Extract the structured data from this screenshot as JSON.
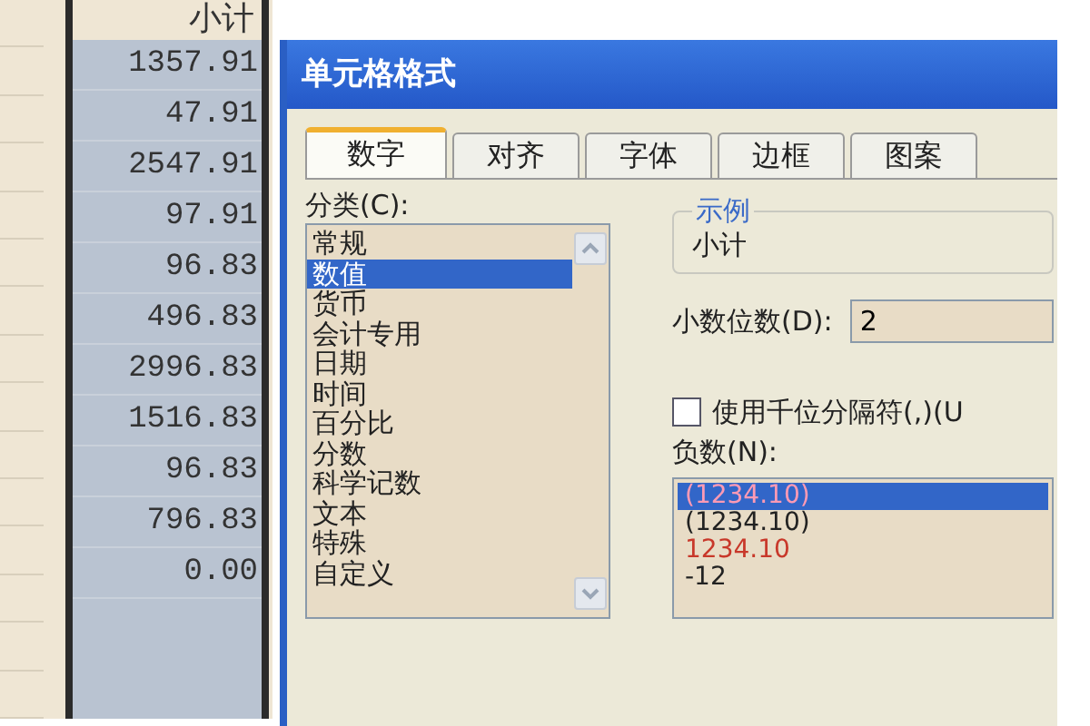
{
  "sheet": {
    "header": "小计",
    "cells": [
      "1357.91",
      "47.91",
      "2547.91",
      "97.91",
      "96.83",
      "496.83",
      "2996.83",
      "1516.83",
      "96.83",
      "796.83",
      "0.00"
    ]
  },
  "dialog": {
    "title": "单元格格式",
    "tabs": [
      {
        "label": "数字",
        "selected": true
      },
      {
        "label": "对齐",
        "selected": false
      },
      {
        "label": "字体",
        "selected": false
      },
      {
        "label": "边框",
        "selected": false
      },
      {
        "label": "图案",
        "selected": false
      }
    ],
    "category": {
      "label": "分类(C):",
      "items": [
        {
          "label": "常规",
          "selected": false
        },
        {
          "label": "数值",
          "selected": true
        },
        {
          "label": "货币",
          "selected": false
        },
        {
          "label": "会计专用",
          "selected": false
        },
        {
          "label": "日期",
          "selected": false
        },
        {
          "label": "时间",
          "selected": false
        },
        {
          "label": "百分比",
          "selected": false
        },
        {
          "label": "分数",
          "selected": false
        },
        {
          "label": "科学记数",
          "selected": false
        },
        {
          "label": "文本",
          "selected": false
        },
        {
          "label": "特殊",
          "selected": false
        },
        {
          "label": "自定义",
          "selected": false
        }
      ]
    },
    "sample": {
      "label": "示例",
      "value": "小计"
    },
    "decimals": {
      "label": "小数位数(D):",
      "value": "2"
    },
    "thousands": {
      "label": "使用千位分隔符(,)(U",
      "checked": false
    },
    "negative": {
      "label": "负数(N):",
      "items": [
        {
          "label": "(1234.10)",
          "selected": true,
          "kind": "red"
        },
        {
          "label": "(1234.10)",
          "selected": false,
          "kind": "plain"
        },
        {
          "label": "1234.10",
          "selected": false,
          "kind": "red"
        },
        {
          "label": "-12",
          "selected": false,
          "kind": "plain"
        }
      ]
    }
  }
}
